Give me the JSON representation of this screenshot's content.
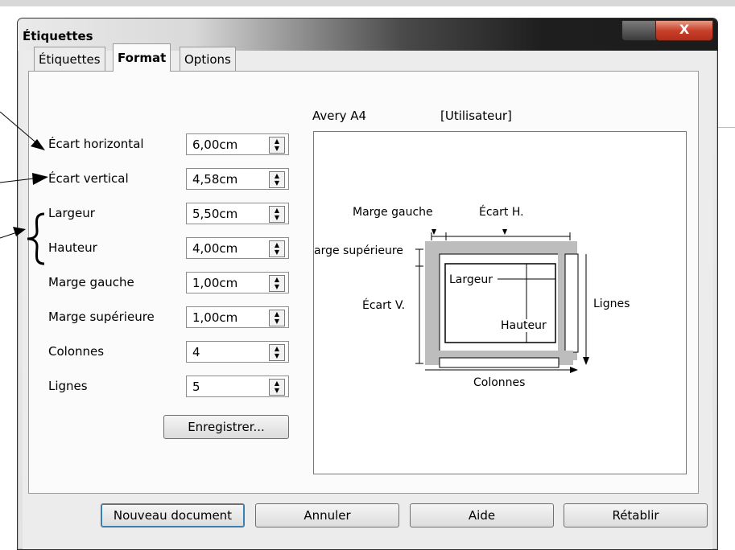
{
  "window": {
    "title": "Étiquettes",
    "close_glyph": "X"
  },
  "tabs": [
    {
      "label": "Étiquettes"
    },
    {
      "label": "Format"
    },
    {
      "label": "Options"
    }
  ],
  "fields": [
    {
      "label": "Écart horizontal",
      "value": "6,00cm"
    },
    {
      "label": "Écart vertical",
      "value": "4,58cm"
    },
    {
      "label": "Largeur",
      "value": "5,50cm"
    },
    {
      "label": "Hauteur",
      "value": "4,00cm"
    },
    {
      "label": "Marge gauche",
      "value": "1,00cm"
    },
    {
      "label": "Marge supérieure",
      "value": "1,00cm"
    },
    {
      "label": "Colonnes",
      "value": "4"
    },
    {
      "label": "Lignes",
      "value": "5"
    }
  ],
  "save_button": "Enregistrer...",
  "preview": {
    "brand": "Avery A4",
    "type": "[Utilisateur]",
    "margin_left": "Marge gauche",
    "gap_h": "Écart H.",
    "margin_top": "arge supérieure",
    "gap_v": "Écart V.",
    "width": "Largeur",
    "height": "Hauteur",
    "rows": "Lignes",
    "columns": "Colonnes"
  },
  "footer": {
    "new_document": "Nouveau document",
    "cancel": "Annuler",
    "help": "Aide",
    "reset": "Rétablir"
  },
  "colors": {
    "accent_close": "#c9412b",
    "label_fill": "#bdbdbd"
  }
}
